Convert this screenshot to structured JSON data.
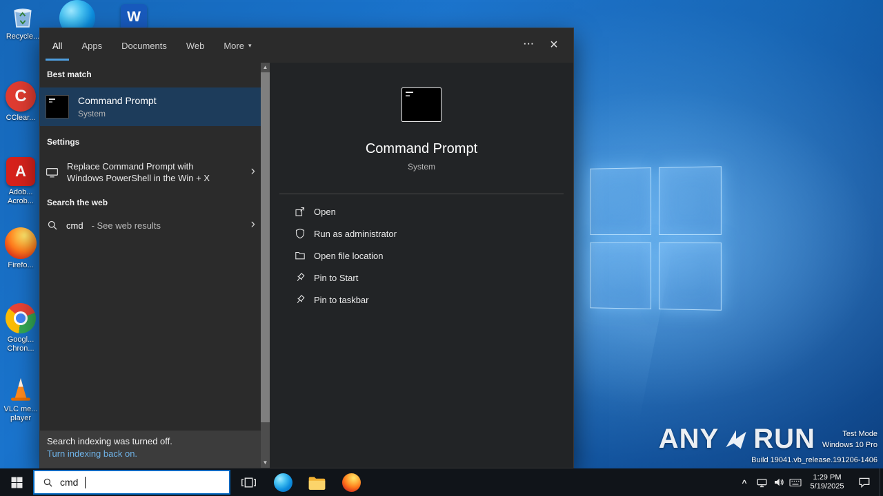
{
  "colors": {
    "accent_underline": "#4f9fe0",
    "selection_highlight": "#1d3c5b",
    "link": "#6fb3e8",
    "taskbar_search_border": "#0067c0",
    "panel_background": "#2b2b2b"
  },
  "icons": {
    "chevron_right": "›",
    "chevron_down": "▾",
    "more_options": "···",
    "close": "×",
    "scroll_up": "▲",
    "scroll_down": "▼",
    "tray_chevron": "^",
    "ccleaner_letter": "C",
    "acrobat_letter": "A",
    "word_letter": "W"
  },
  "desktop": {
    "labels": {
      "recycle_bin": [
        "Recycle..."
      ],
      "ccleaner": [
        "CClear..."
      ],
      "acrobat": [
        "Adob...",
        "Acrob..."
      ],
      "firefox": [
        "Firefo..."
      ],
      "chrome": [
        "Googl...",
        "Chron..."
      ],
      "vlc": [
        "VLC me...",
        "player"
      ]
    }
  },
  "search_panel": {
    "tabs": [
      {
        "label": "All",
        "active": true
      },
      {
        "label": "Apps",
        "active": false
      },
      {
        "label": "Documents",
        "active": false
      },
      {
        "label": "Web",
        "active": false
      },
      {
        "label": "More",
        "active": false
      }
    ],
    "sections": {
      "best_match": "Best match",
      "settings": "Settings",
      "web": "Search the web"
    },
    "best_match_item": {
      "title": "Command Prompt",
      "subtitle": "System"
    },
    "settings_item": {
      "line1": "Replace Command Prompt with",
      "line2": "Windows PowerShell in the Win + X"
    },
    "web_item": {
      "query": "cmd",
      "suffix": " - See web results"
    },
    "footer": {
      "message": "Search indexing was turned off.",
      "link": "Turn indexing back on."
    },
    "preview": {
      "title": "Command Prompt",
      "subtitle": "System",
      "actions": [
        {
          "label": "Open"
        },
        {
          "label": "Run as administrator"
        },
        {
          "label": "Open file location"
        },
        {
          "label": "Pin to Start"
        },
        {
          "label": "Pin to taskbar"
        }
      ]
    }
  },
  "taskbar": {
    "search_value": "cmd",
    "clock": {
      "time": "1:29 PM",
      "date": "5/19/2025"
    }
  },
  "watermark": {
    "brand_left": "ANY",
    "brand_right": "RUN",
    "lines": [
      "Test Mode",
      "Windows 10 Pro",
      "Build 19041.vb_release.191206-1406"
    ]
  }
}
